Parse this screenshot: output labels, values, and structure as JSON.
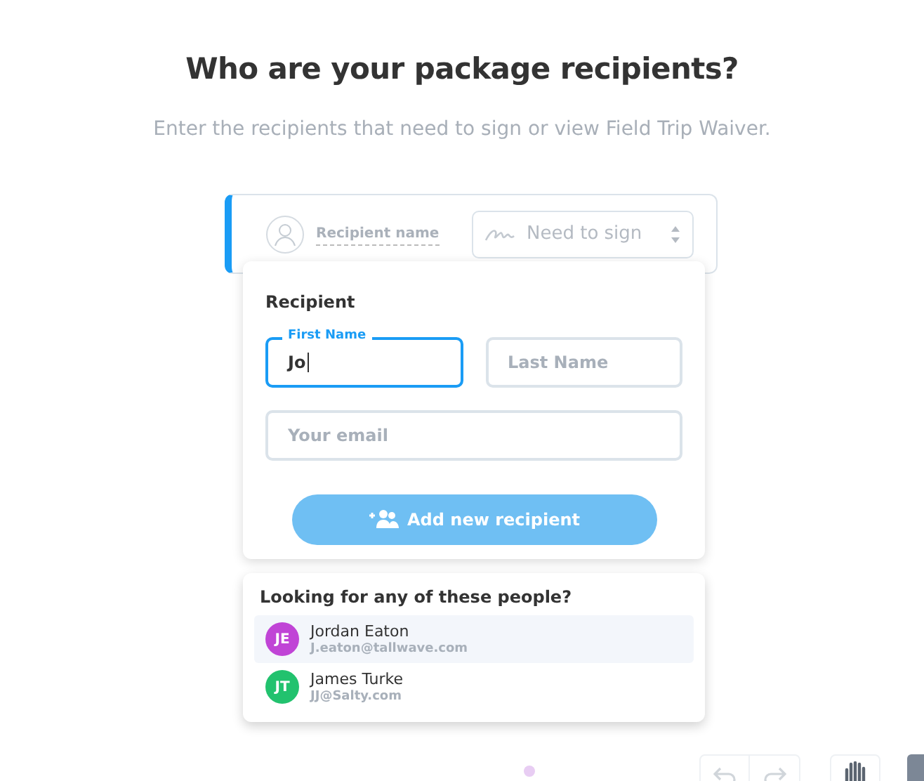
{
  "title": "Who are your package recipients?",
  "subtitle": "Enter the recipients that need to sign or view Field Trip Waiver.",
  "recipient_row": {
    "name_placeholder": "Recipient name",
    "role": "Need to sign"
  },
  "popup": {
    "heading": "Recipient",
    "fields": [
      {
        "label": "First Name",
        "value": "Jo",
        "focused": true
      },
      {
        "placeholder": "Last Name",
        "focused": false
      },
      {
        "placeholder": "Your email",
        "focused": false
      }
    ],
    "button": {
      "label": "Add new recipient",
      "disabled": true
    }
  },
  "suggestions": {
    "heading": "Looking for any of these people?",
    "people": [
      {
        "initials": "JE",
        "name": "Jordan Eaton",
        "email": "J.eaton@tallwave.com",
        "color": "#c044d6",
        "selected": true
      },
      {
        "initials": "JT",
        "name": "James Turke",
        "email": "JJ@Salty.com",
        "color": "#22c26e",
        "selected": false
      }
    ]
  }
}
